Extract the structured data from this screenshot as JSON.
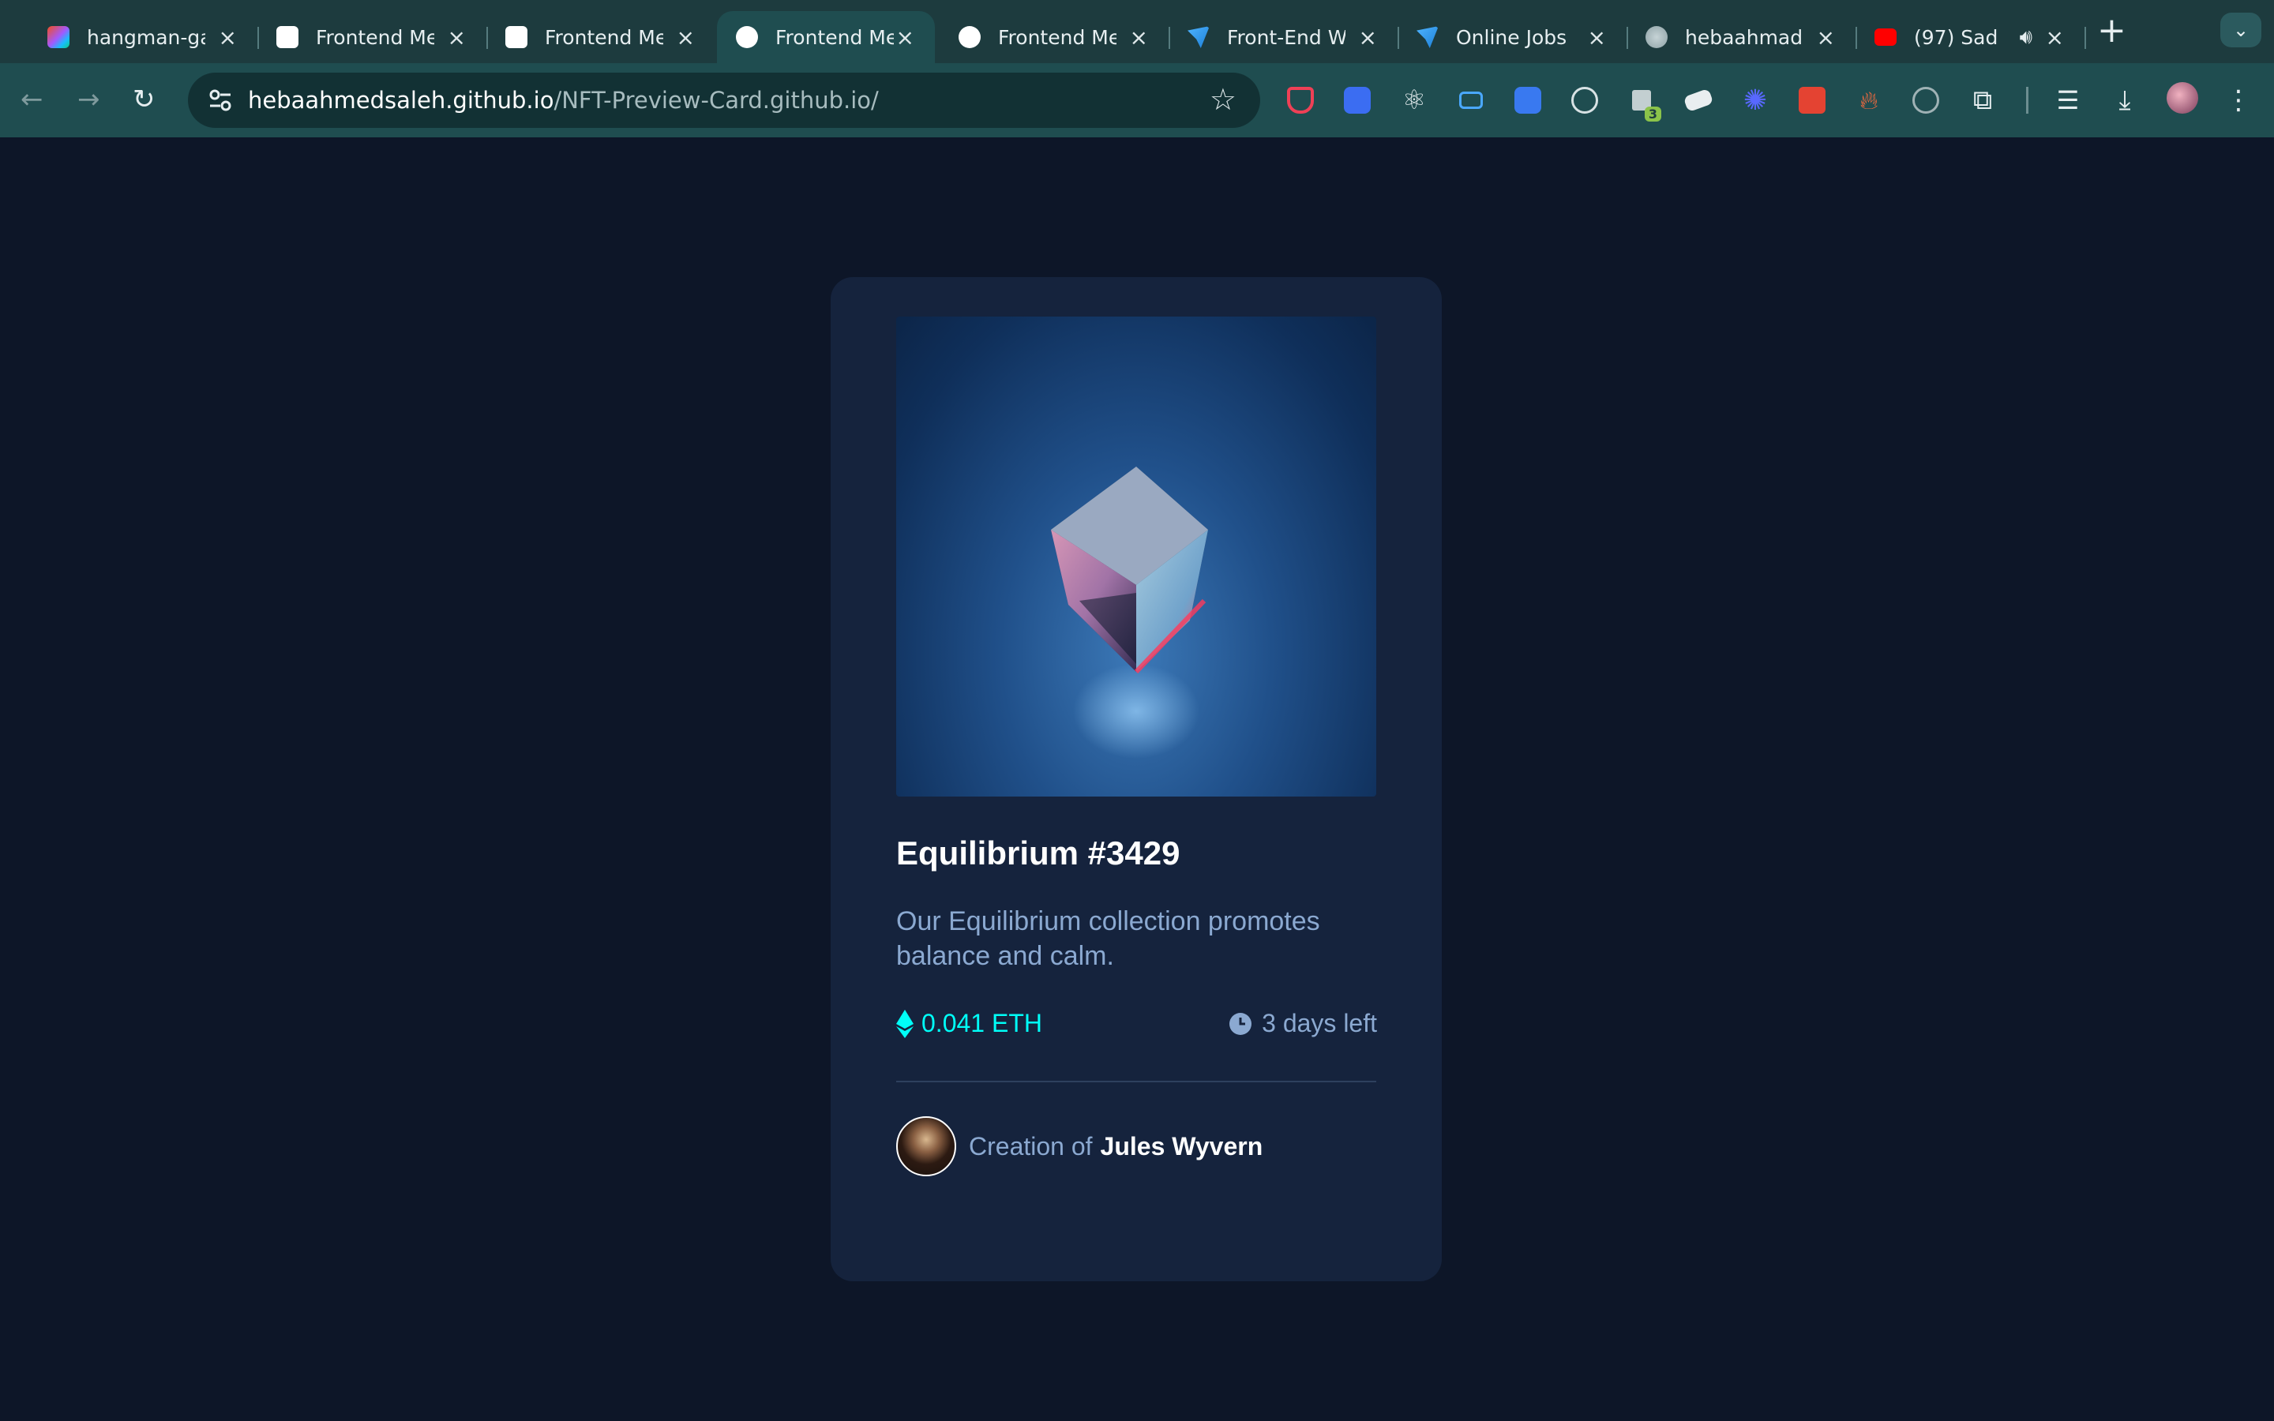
{
  "browser": {
    "tabs": [
      {
        "title": "hangman-ga",
        "icon": "figma-icon",
        "active": false,
        "audio": false
      },
      {
        "title": "Frontend Me",
        "icon": "frontend-mentor-icon",
        "active": false,
        "audio": false
      },
      {
        "title": "Frontend Me",
        "icon": "frontend-mentor-icon",
        "active": false,
        "audio": false
      },
      {
        "title": "Frontend Me",
        "icon": "frontend-mentor-icon",
        "active": true,
        "audio": false
      },
      {
        "title": "Frontend Me",
        "icon": "frontend-mentor-icon",
        "active": false,
        "audio": false
      },
      {
        "title": "Front-End W",
        "icon": "bird-icon",
        "active": false,
        "audio": false
      },
      {
        "title": "Online Jobs",
        "icon": "bird-icon",
        "active": false,
        "audio": false
      },
      {
        "title": "hebaahmads",
        "icon": "globe-icon",
        "active": false,
        "audio": false
      },
      {
        "title": "(97) Sad",
        "icon": "youtube-icon",
        "active": false,
        "audio": true
      }
    ],
    "new_tab_symbol": "+",
    "tab_list_symbol": "⌄",
    "url_host": "hebaahmedsaleh.github.io",
    "url_path": "/NFT-Preview-Card.github.io/",
    "extension_badge": "3"
  },
  "card": {
    "image_alt": "equilibrium-crystal-image",
    "title": "Equilibrium #3429",
    "description": "Our Equilibrium collection promotes balance and calm.",
    "price": "0.041 ETH",
    "time_left": "3 days left",
    "creator_label": "Creation of",
    "creator_name": "Jules Wyvern"
  },
  "colors": {
    "page_bg": "#0d1628",
    "card_bg": "#15233d",
    "accent_cyan": "#00fff8",
    "soft_blue": "#8ba9d1",
    "line": "#2e405e"
  }
}
